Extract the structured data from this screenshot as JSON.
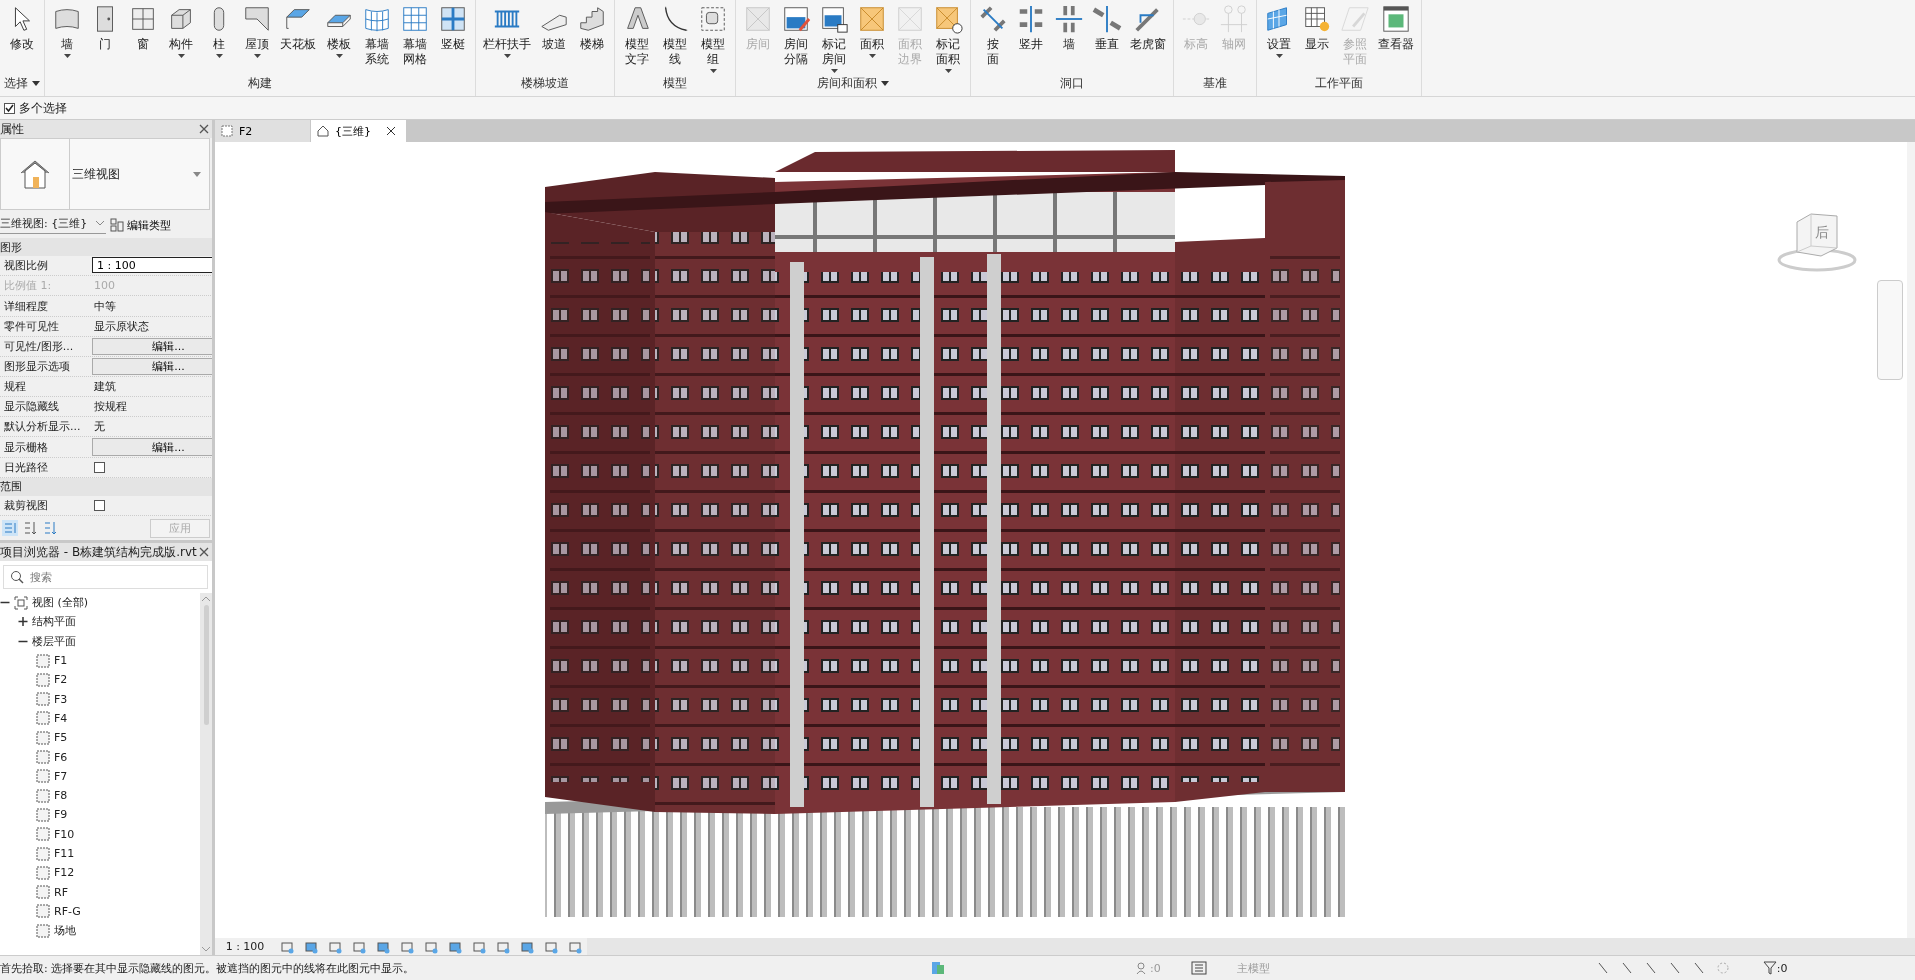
{
  "ribbon": {
    "panels": [
      {
        "title": "选择",
        "menu": true,
        "tools": [
          {
            "label": "修改",
            "dropdown": false,
            "disabled": false
          }
        ]
      },
      {
        "title": "构建",
        "menu": false,
        "tools": [
          {
            "label": "墙",
            "dropdown": true,
            "disabled": false
          },
          {
            "label": "门",
            "dropdown": false,
            "disabled": false
          },
          {
            "label": "窗",
            "dropdown": false,
            "disabled": false
          },
          {
            "label": "构件",
            "dropdown": true,
            "disabled": false
          },
          {
            "label": "柱",
            "dropdown": true,
            "disabled": false
          },
          {
            "label": "屋顶",
            "dropdown": true,
            "disabled": false
          },
          {
            "label": "天花板",
            "dropdown": false,
            "disabled": false
          },
          {
            "label": "楼板",
            "dropdown": true,
            "disabled": false
          },
          {
            "lines": [
              "幕墙",
              "系统"
            ],
            "dropdown": false,
            "disabled": false
          },
          {
            "lines": [
              "幕墙",
              "网格"
            ],
            "dropdown": false,
            "disabled": false
          },
          {
            "label": "竖梃",
            "dropdown": false,
            "disabled": false
          }
        ]
      },
      {
        "title": "楼梯坡道",
        "menu": false,
        "tools": [
          {
            "label": "栏杆扶手",
            "dropdown": true,
            "disabled": false
          },
          {
            "label": "坡道",
            "dropdown": false,
            "disabled": false
          },
          {
            "label": "楼梯",
            "dropdown": false,
            "disabled": false
          }
        ]
      },
      {
        "title": "模型",
        "menu": false,
        "tools": [
          {
            "lines": [
              "模型",
              "文字"
            ],
            "dropdown": false,
            "disabled": false
          },
          {
            "lines": [
              "模型",
              "线"
            ],
            "dropdown": false,
            "disabled": false
          },
          {
            "lines": [
              "模型",
              "组"
            ],
            "dropdown": true,
            "disabled": false
          }
        ]
      },
      {
        "title": "房间和面积",
        "menu": true,
        "tools": [
          {
            "label": "房间",
            "dropdown": false,
            "disabled": true
          },
          {
            "lines": [
              "房间",
              "分隔"
            ],
            "dropdown": false,
            "disabled": false
          },
          {
            "lines": [
              "标记",
              "房间"
            ],
            "dropdown": true,
            "disabled": false
          },
          {
            "label": "面积",
            "dropdown": true,
            "disabled": false
          },
          {
            "lines": [
              "面积",
              "边界"
            ],
            "dropdown": false,
            "disabled": true
          },
          {
            "lines": [
              "标记",
              "面积"
            ],
            "dropdown": true,
            "disabled": false
          }
        ]
      },
      {
        "title": "洞口",
        "menu": false,
        "tools": [
          {
            "lines": [
              "按",
              "面"
            ],
            "dropdown": false,
            "disabled": false
          },
          {
            "label": "竖井",
            "dropdown": false,
            "disabled": false
          },
          {
            "label": "墙",
            "dropdown": false,
            "disabled": false
          },
          {
            "label": "垂直",
            "dropdown": false,
            "disabled": false
          },
          {
            "label": "老虎窗",
            "dropdown": false,
            "disabled": false
          }
        ]
      },
      {
        "title": "基准",
        "menu": false,
        "tools": [
          {
            "label": "标高",
            "dropdown": false,
            "disabled": true
          },
          {
            "label": "轴网",
            "dropdown": false,
            "disabled": true
          }
        ]
      },
      {
        "title": "工作平面",
        "menu": false,
        "tools": [
          {
            "label": "设置",
            "dropdown": true,
            "disabled": false
          },
          {
            "label": "显示",
            "dropdown": false,
            "disabled": false
          },
          {
            "lines": [
              "参照",
              "平面"
            ],
            "dropdown": false,
            "disabled": true
          },
          {
            "label": "查看器",
            "dropdown": false,
            "disabled": false
          }
        ]
      }
    ]
  },
  "options_bar": {
    "multi_select": {
      "label": "多个选择",
      "checked": true
    }
  },
  "properties": {
    "title": "属性",
    "type_name": "三维视图",
    "instance_selector": "三维视图: {三维}",
    "edit_type": "编辑类型",
    "sections": [
      {
        "title": "图形",
        "expanded": true,
        "rows": [
          {
            "name": "视图比例",
            "kind": "field",
            "value": "1 : 100",
            "disabled": false
          },
          {
            "name": "比例值 1:",
            "kind": "text",
            "value": "100",
            "disabled": true
          },
          {
            "name": "详细程度",
            "kind": "text",
            "value": "中等",
            "disabled": false
          },
          {
            "name": "零件可见性",
            "kind": "text",
            "value": "显示原状态",
            "disabled": false
          },
          {
            "name": "可见性/图形...",
            "kind": "button",
            "value": "编辑...",
            "disabled": false
          },
          {
            "name": "图形显示选项",
            "kind": "button",
            "value": "编辑...",
            "disabled": false
          },
          {
            "name": "规程",
            "kind": "text",
            "value": "建筑",
            "disabled": false
          },
          {
            "name": "显示隐藏线",
            "kind": "text",
            "value": "按规程",
            "disabled": false
          },
          {
            "name": "默认分析显示...",
            "kind": "text",
            "value": "无",
            "disabled": false
          },
          {
            "name": "显示栅格",
            "kind": "button",
            "value": "编辑...",
            "disabled": false
          },
          {
            "name": "日光路径",
            "kind": "checkbox",
            "checked": false,
            "disabled": false
          }
        ]
      },
      {
        "title": "范围",
        "expanded": true,
        "rows": [
          {
            "name": "裁剪视图",
            "kind": "checkbox",
            "checked": false,
            "disabled": false
          }
        ]
      }
    ],
    "apply": "应用"
  },
  "project_browser": {
    "title": "项目浏览器 - B栋建筑结构完成版.rvt",
    "search": {
      "placeholder": "搜索"
    },
    "tree": [
      {
        "label": "视图 (全部)",
        "expanded": true,
        "children": [
          {
            "label": "结构平面",
            "expanded": false
          },
          {
            "label": "楼层平面",
            "expanded": true,
            "children": [
              {
                "label": "F1"
              },
              {
                "label": "F2"
              },
              {
                "label": "F3"
              },
              {
                "label": "F4"
              },
              {
                "label": "F5"
              },
              {
                "label": "F6"
              },
              {
                "label": "F7"
              },
              {
                "label": "F8"
              },
              {
                "label": "F9"
              },
              {
                "label": "F10"
              },
              {
                "label": "F11"
              },
              {
                "label": "F12"
              },
              {
                "label": "RF"
              },
              {
                "label": "RF-G"
              },
              {
                "label": "场地"
              }
            ]
          }
        ]
      }
    ]
  },
  "view_tabs": [
    {
      "label": "F2",
      "selected": false
    },
    {
      "label": "{三维}",
      "selected": true
    }
  ],
  "view_control_bar": {
    "scale": "1 : 100"
  },
  "view_cube": {
    "face": "后"
  },
  "status_bar": {
    "message": "首先拾取: 选择要在其中显示隐藏线的图元。被遮挡的图元中的线将在此图元中显示。",
    "workset_count": ":0",
    "model": "主模型",
    "filter_count": ":0"
  }
}
